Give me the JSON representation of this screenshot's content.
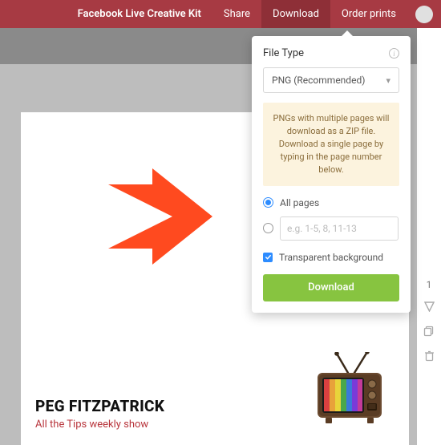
{
  "topbar": {
    "title": "Facebook Live Creative Kit",
    "share": "Share",
    "download": "Download",
    "order_prints": "Order prints"
  },
  "dropdown": {
    "title": "File Type",
    "select_value": "PNG (Recommended)",
    "notice": "PNGs with multiple pages will download as a ZIP file. Download a single page by typing in the page number below.",
    "all_pages_label": "All pages",
    "range_placeholder": "e.g. 1-5, 8, 11-13",
    "transparent_label": "Transparent background",
    "download_btn": "Download"
  },
  "page": {
    "heading": "PEG FITZPATRICK",
    "subheading": "All the Tips weekly show"
  },
  "rail": {
    "page_number": "1"
  }
}
